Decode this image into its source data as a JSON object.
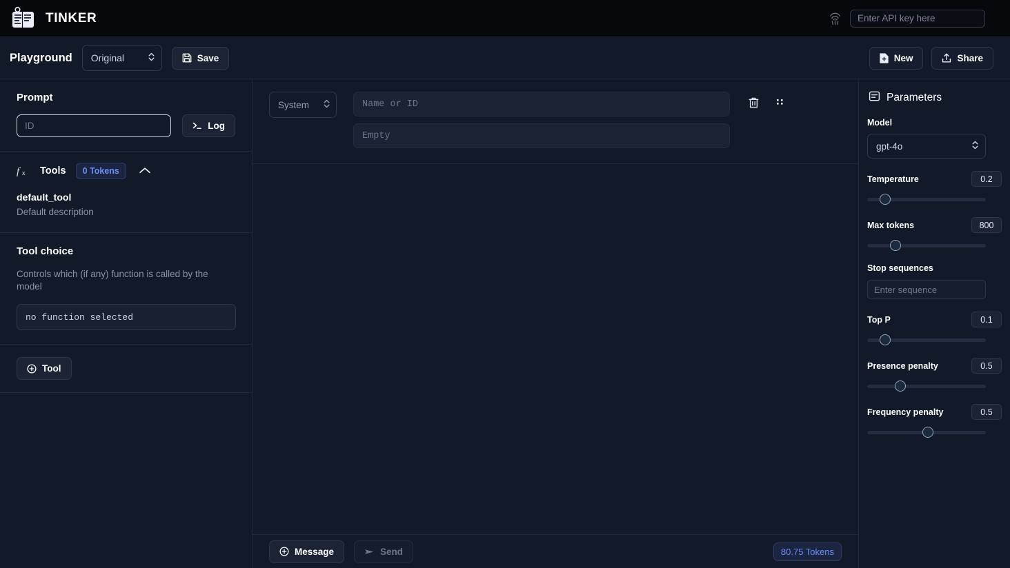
{
  "header": {
    "brand": "TINKER",
    "brand_icon": "notebook-logo-icon",
    "fingerprint_icon": "fingerprint-icon",
    "api_key_placeholder": "Enter API key here",
    "api_key_value": ""
  },
  "toolbar": {
    "page_title": "Playground",
    "preset_value": "Original",
    "save_label": "Save",
    "new_label": "New",
    "share_label": "Share"
  },
  "sidebar": {
    "prompt_title": "Prompt",
    "id_placeholder": "ID",
    "id_value": "",
    "log_label": "Log",
    "tools_label": "Tools",
    "tools_badge": "0 Tokens",
    "tool_name": "default_tool",
    "tool_description": "Default description",
    "tool_choice_title": "Tool choice",
    "tool_choice_description": "Controls which (if any) function is called by the model",
    "tool_choice_value": "no function selected",
    "add_tool_label": "Tool"
  },
  "message": {
    "role_value": "System",
    "name_placeholder": "Name or ID",
    "name_value": "",
    "content_placeholder": "Empty",
    "content_value": "",
    "delete_icon": "trash-icon",
    "drag_icon": "drag-handle-icon"
  },
  "footer": {
    "message_label": "Message",
    "send_label": "Send",
    "tokens_label": "80.75 Tokens"
  },
  "params": {
    "title": "Parameters",
    "model_label": "Model",
    "model_value": "gpt-4o",
    "stop_label": "Stop sequences",
    "stop_placeholder": "Enter sequence",
    "stop_value": "",
    "sliders": [
      {
        "label": "Temperature",
        "value": "0.2",
        "percent": 15
      },
      {
        "label": "Max tokens",
        "value": "800",
        "percent": 24
      },
      {
        "label": "Top P",
        "value": "0.1",
        "percent": 15
      },
      {
        "label": "Presence penalty",
        "value": "0.5",
        "percent": 28
      },
      {
        "label": "Frequency penalty",
        "value": "0.5",
        "percent": 51
      }
    ]
  },
  "colors": {
    "accent_blue": "#6d8ff5",
    "panel": "#121929",
    "header": "#07080c",
    "border": "#222b3d"
  }
}
